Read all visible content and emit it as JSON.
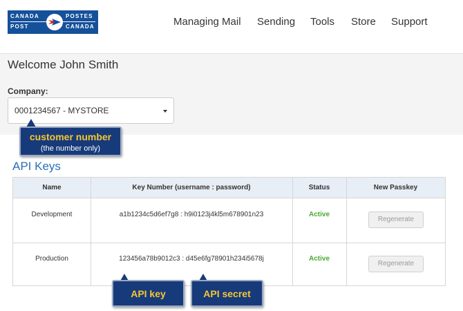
{
  "header": {
    "logo": {
      "line1_left": "CANADA",
      "line2_left": "POST",
      "line1_right": "POSTES",
      "line2_right": "CANADA"
    },
    "nav": [
      "Managing Mail",
      "Sending",
      "Tools",
      "Store",
      "Support"
    ]
  },
  "account": {
    "welcome": "Welcome John Smith",
    "company_label": "Company:",
    "company_value": "0001234567 - MYSTORE"
  },
  "annotations": {
    "customer_title": "customer number",
    "customer_sub": "(the number only)",
    "api_key": "API key",
    "api_secret": "API secret"
  },
  "api_keys": {
    "title": "API Keys",
    "columns": [
      "Name",
      "Key Number (username : password)",
      "Status",
      "New Passkey"
    ],
    "rows": [
      {
        "name": "Development",
        "key": "a1b1234c5d6ef7g8 : h9i0123j4kl5m678901n23",
        "status": "Active",
        "action": "Regenerate"
      },
      {
        "name": "Production",
        "key": "123456a78b9012c3 : d45e6fg78901h234i5678j",
        "status": "Active",
        "action": "Regenerate"
      }
    ]
  },
  "colors": {
    "brand": "#15509a",
    "link": "#2a6ebb",
    "status_active": "#4aa832",
    "callout_bg": "#173a7a",
    "callout_title": "#f7c733"
  }
}
